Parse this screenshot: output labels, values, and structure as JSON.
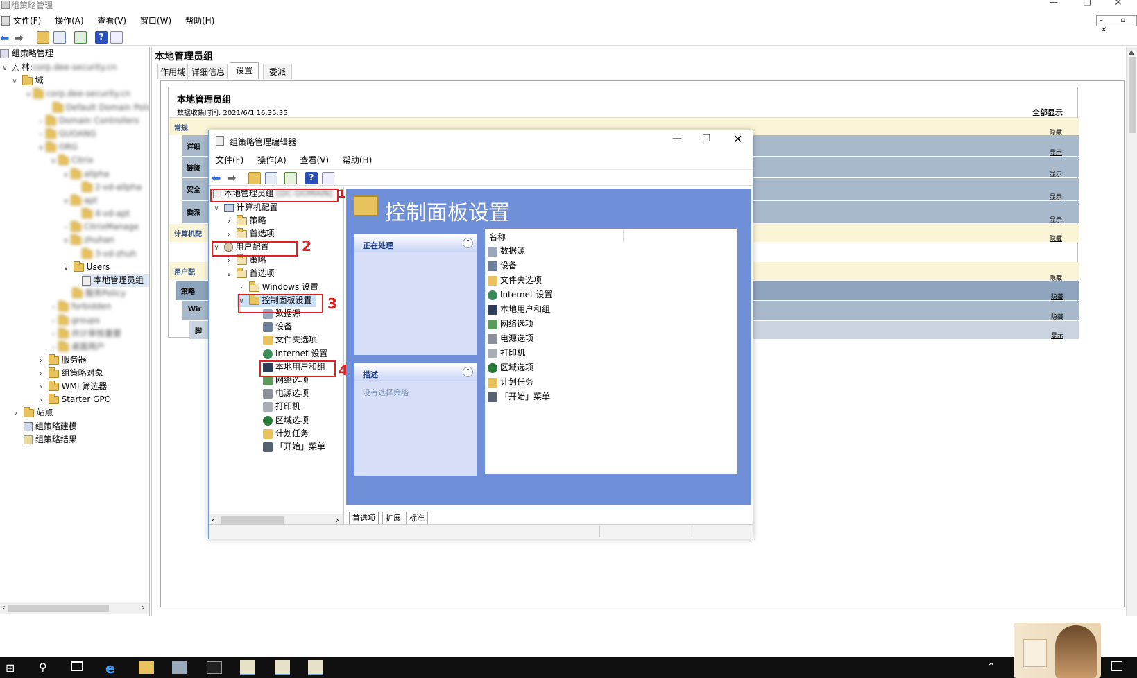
{
  "main_window": {
    "title": "组策略管理",
    "menu": [
      "文件(F)",
      "操作(A)",
      "查看(V)",
      "窗口(W)",
      "帮助(H)"
    ],
    "right_title": "本地管理员组",
    "tabs": [
      "作用域",
      "详细信息",
      "设置",
      "委派"
    ],
    "active_tab": "设置"
  },
  "left_tree": {
    "root": "组策略管理",
    "forest": "林:",
    "domains": "域",
    "users_ou": "Users",
    "gpo_item": "本地管理员组",
    "servers": "服务器",
    "gpo_objects": "组策略对象",
    "wmi": "WMI 筛选器",
    "starter": "Starter GPO",
    "sites": "站点",
    "modeling": "组策略建模",
    "results": "组策略结果"
  },
  "report": {
    "title": "本地管理员组",
    "collected": "数据收集时间: 2021/6/1 16:35:35",
    "show_all": "全部显示",
    "general": "常规",
    "details": "详细",
    "links": "链接",
    "security": "安全",
    "delegation": "委派",
    "computer_config": "计算机配",
    "user_config": "用户配",
    "policy": "策略",
    "windows": "Wir",
    "script": "脚",
    "hide": "隐藏",
    "show": "显示"
  },
  "editor": {
    "title": "组策略管理编辑器",
    "menu": [
      "文件(F)",
      "操作(A)",
      "查看(V)",
      "帮助(H)"
    ],
    "tree": {
      "root": "本地管理员组",
      "computer_config": "计算机配置",
      "policy": "策略",
      "prefs": "首选项",
      "user_config": "用户配置",
      "policy2": "策略",
      "prefs2": "首选项",
      "windows_settings": "Windows 设置",
      "control_panel": "控制面板设置",
      "items": [
        "数据源",
        "设备",
        "文件夹选项",
        "Internet 设置",
        "本地用户和组",
        "网络选项",
        "电源选项",
        "打印机",
        "区域选项",
        "计划任务",
        "「开始」菜单"
      ]
    },
    "content_title": "控制面板设置",
    "processing": "正在处理",
    "description": "描述",
    "no_policy": "没有选择策略",
    "column_name": "名称",
    "list": [
      "数据源",
      "设备",
      "文件夹选项",
      "Internet 设置",
      "本地用户和组",
      "网络选项",
      "电源选项",
      "打印机",
      "区域选项",
      "计划任务",
      "「开始」菜单"
    ],
    "bottom_tabs": [
      "首选项",
      "扩展",
      "标准"
    ]
  },
  "annotations": [
    "1",
    "2",
    "3",
    "4"
  ],
  "colors": {
    "editor_blue": "#6f8fd8",
    "panel_light": "#d6dff7",
    "section_yellow": "#fbf5d8",
    "section_blue": "#a8b9cc",
    "taskbar": "#101010",
    "annotation_red": "#e02020"
  }
}
